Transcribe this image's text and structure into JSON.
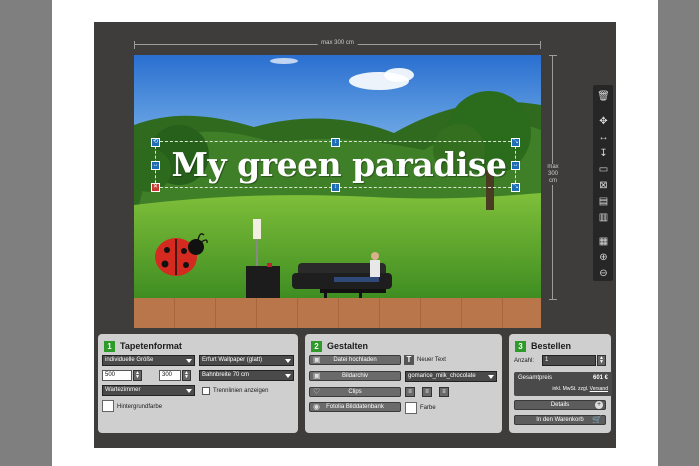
{
  "canvas": {
    "width_label": "max 300 cm",
    "height_label": "max 300 cm",
    "headline": "My green paradise"
  },
  "toolbar": {
    "tools": [
      "trash-icon",
      "move-icon",
      "resize-width-icon",
      "resize-height-icon",
      "bring-front-icon",
      "send-back-icon",
      "layer-up-icon",
      "layer-down-icon",
      "grid-icon",
      "zoom-in-icon",
      "zoom-out-icon"
    ]
  },
  "panel1": {
    "number": "1",
    "title": "Tapetenformat",
    "size_select": "individuelle Größe",
    "wallpaper_select": "Erfurt Wallpaper (glatt)",
    "width_value": "500",
    "height_value": "300",
    "strip_select": "Bahnbreite 70 cm",
    "room_select": "Wartezimmer",
    "divider_label": "Trennlinien anzeigen",
    "bg_color_label": "Hintergrundfarbe"
  },
  "panel2": {
    "number": "2",
    "title": "Gestalten",
    "upload_button": "Datei hochladen",
    "archive_button": "Bildarchiv",
    "clips_button": "Clips",
    "fotolia_button": "Fotolia Bilddatenbank",
    "new_text_label": "Neuer Text",
    "font_select": "gomarice_milk_chocolate",
    "color_label": "Farbe"
  },
  "panel3": {
    "number": "3",
    "title": "Bestellen",
    "quantity_label": "Anzahl:",
    "quantity_value": "1",
    "total_label": "Gesamtpreis",
    "total_value": "601 €",
    "tax_note": "inkl. MwSt. zzgl.",
    "shipping_link": "Versand",
    "details_button": "Details",
    "cart_button": "In den Warenkorb"
  }
}
